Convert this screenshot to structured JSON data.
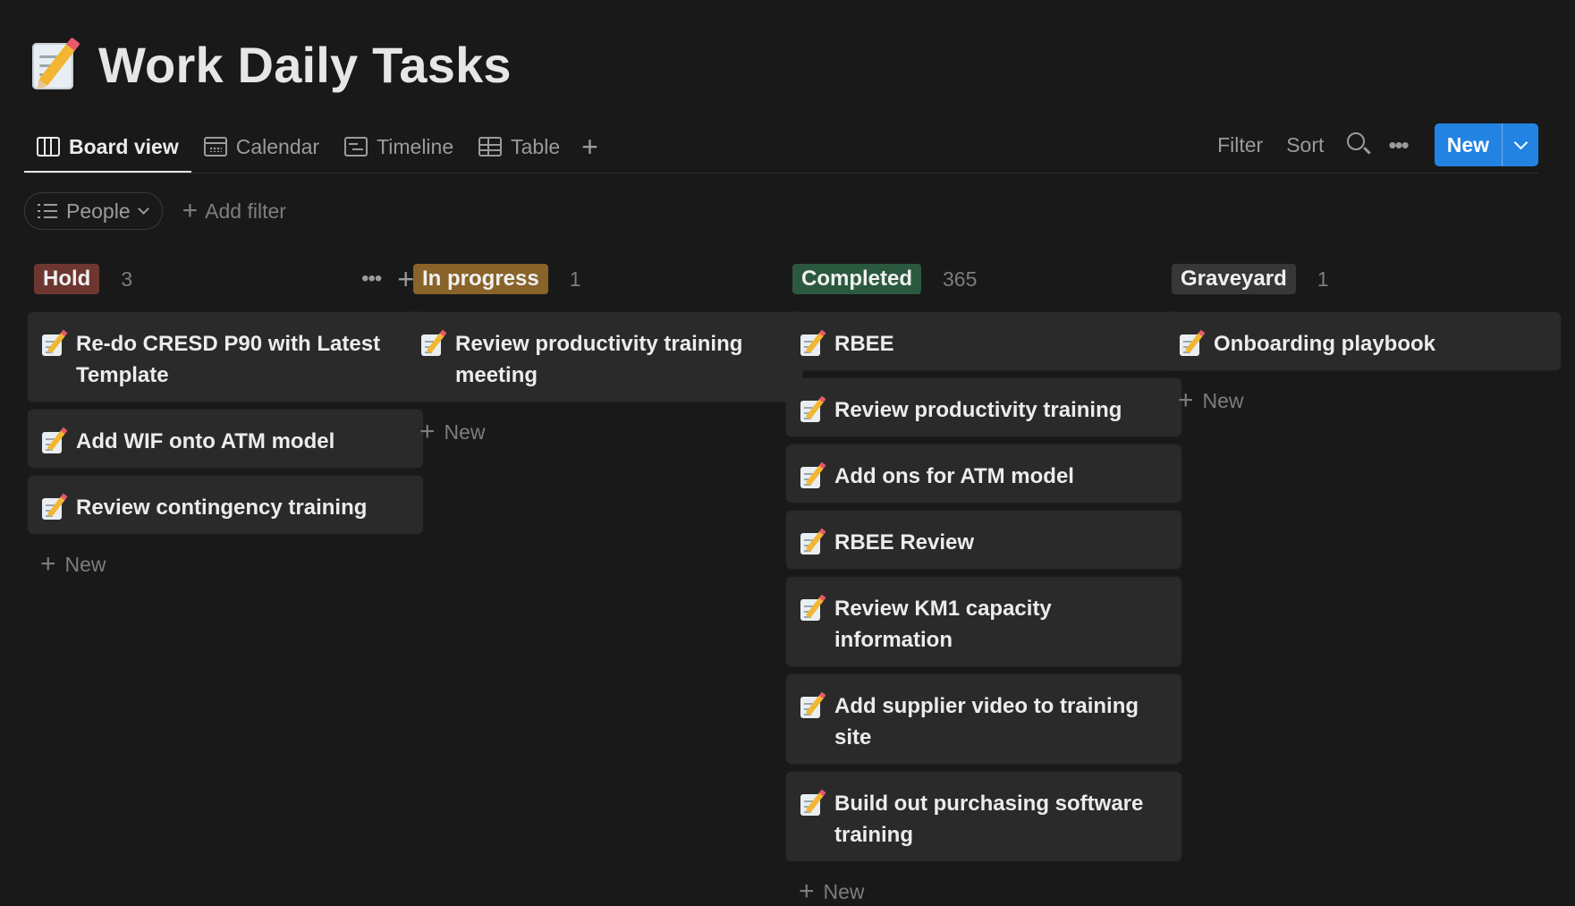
{
  "page": {
    "title": "Work Daily Tasks",
    "icon": "memo-icon"
  },
  "tabs": [
    {
      "label": "Board view",
      "icon": "board-icon",
      "active": true
    },
    {
      "label": "Calendar",
      "icon": "calendar-icon",
      "active": false
    },
    {
      "label": "Timeline",
      "icon": "timeline-icon",
      "active": false
    },
    {
      "label": "Table",
      "icon": "table-icon",
      "active": false
    }
  ],
  "toolbar": {
    "filter": "Filter",
    "sort": "Sort",
    "new": "New"
  },
  "filters": {
    "group_by": "People",
    "add_filter": "Add filter"
  },
  "colors": {
    "accent": "#2383e2",
    "background": "#191919",
    "card": "#2a2a2a"
  },
  "columns": [
    {
      "name": "Hold",
      "count": "3",
      "color": "#6e3630",
      "cards": [
        "Re-do CRESD P90 with Latest Template",
        "Add WIF onto ATM model",
        "Review contingency training"
      ],
      "new_label": "New"
    },
    {
      "name": "In progress",
      "count": "1",
      "color": "#89632a",
      "cards": [
        "Review productivity training meeting"
      ],
      "new_label": "New"
    },
    {
      "name": "Completed",
      "count": "365",
      "color": "#2b593f",
      "cards": [
        "RBEE",
        "Review productivity training",
        "Add ons for ATM model",
        "RBEE Review",
        "Review KM1 capacity information",
        "Add supplier video to training site",
        "Build out purchasing software training"
      ],
      "new_label": "New"
    },
    {
      "name": "Graveyard",
      "count": "1",
      "color": "#373737",
      "cards": [
        "Onboarding playbook"
      ],
      "new_label": "New"
    }
  ]
}
